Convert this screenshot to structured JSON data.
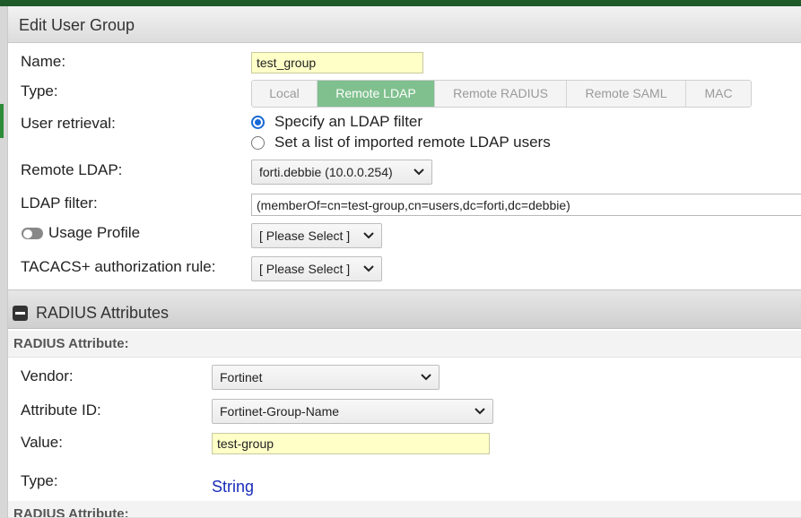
{
  "form": {
    "title": "Edit User Group",
    "name": {
      "label": "Name:",
      "value": "test_group"
    },
    "type": {
      "label": "Type:",
      "options": [
        "Local",
        "Remote LDAP",
        "Remote RADIUS",
        "Remote SAML",
        "MAC"
      ],
      "selected": "Remote LDAP"
    },
    "user_retrieval": {
      "label": "User retrieval:",
      "options": [
        "Specify an LDAP filter",
        "Set a list of imported remote LDAP users"
      ],
      "selected": "Specify an LDAP filter"
    },
    "remote_ldap": {
      "label": "Remote LDAP:",
      "value": "forti.debbie (10.0.0.254)"
    },
    "ldap_filter": {
      "label": "LDAP filter:",
      "value": "(memberOf=cn=test-group,cn=users,dc=forti,dc=debbie)"
    },
    "usage_profile": {
      "label": "Usage Profile",
      "enabled": false,
      "value": "[ Please Select ]"
    },
    "tacacs": {
      "label": "TACACS+ authorization rule:",
      "value": "[ Please Select ]"
    }
  },
  "radius": {
    "section_title": "RADIUS Attributes",
    "attribute_header": "RADIUS Attribute:",
    "vendor": {
      "label": "Vendor:",
      "value": "Fortinet"
    },
    "attribute_id": {
      "label": "Attribute ID:",
      "value": "Fortinet-Group-Name"
    },
    "value": {
      "label": "Value:",
      "value": "test-group"
    },
    "type": {
      "label": "Type:",
      "value": "String"
    },
    "next_attribute_header": "RADIUS Attribute:"
  },
  "colors": {
    "top_bar": "#1f5a2a",
    "active_tab": "#7fc08e",
    "input_highlight": "#ffffc8",
    "radio_accent": "#1769d6",
    "value_link": "#1a2db8"
  }
}
